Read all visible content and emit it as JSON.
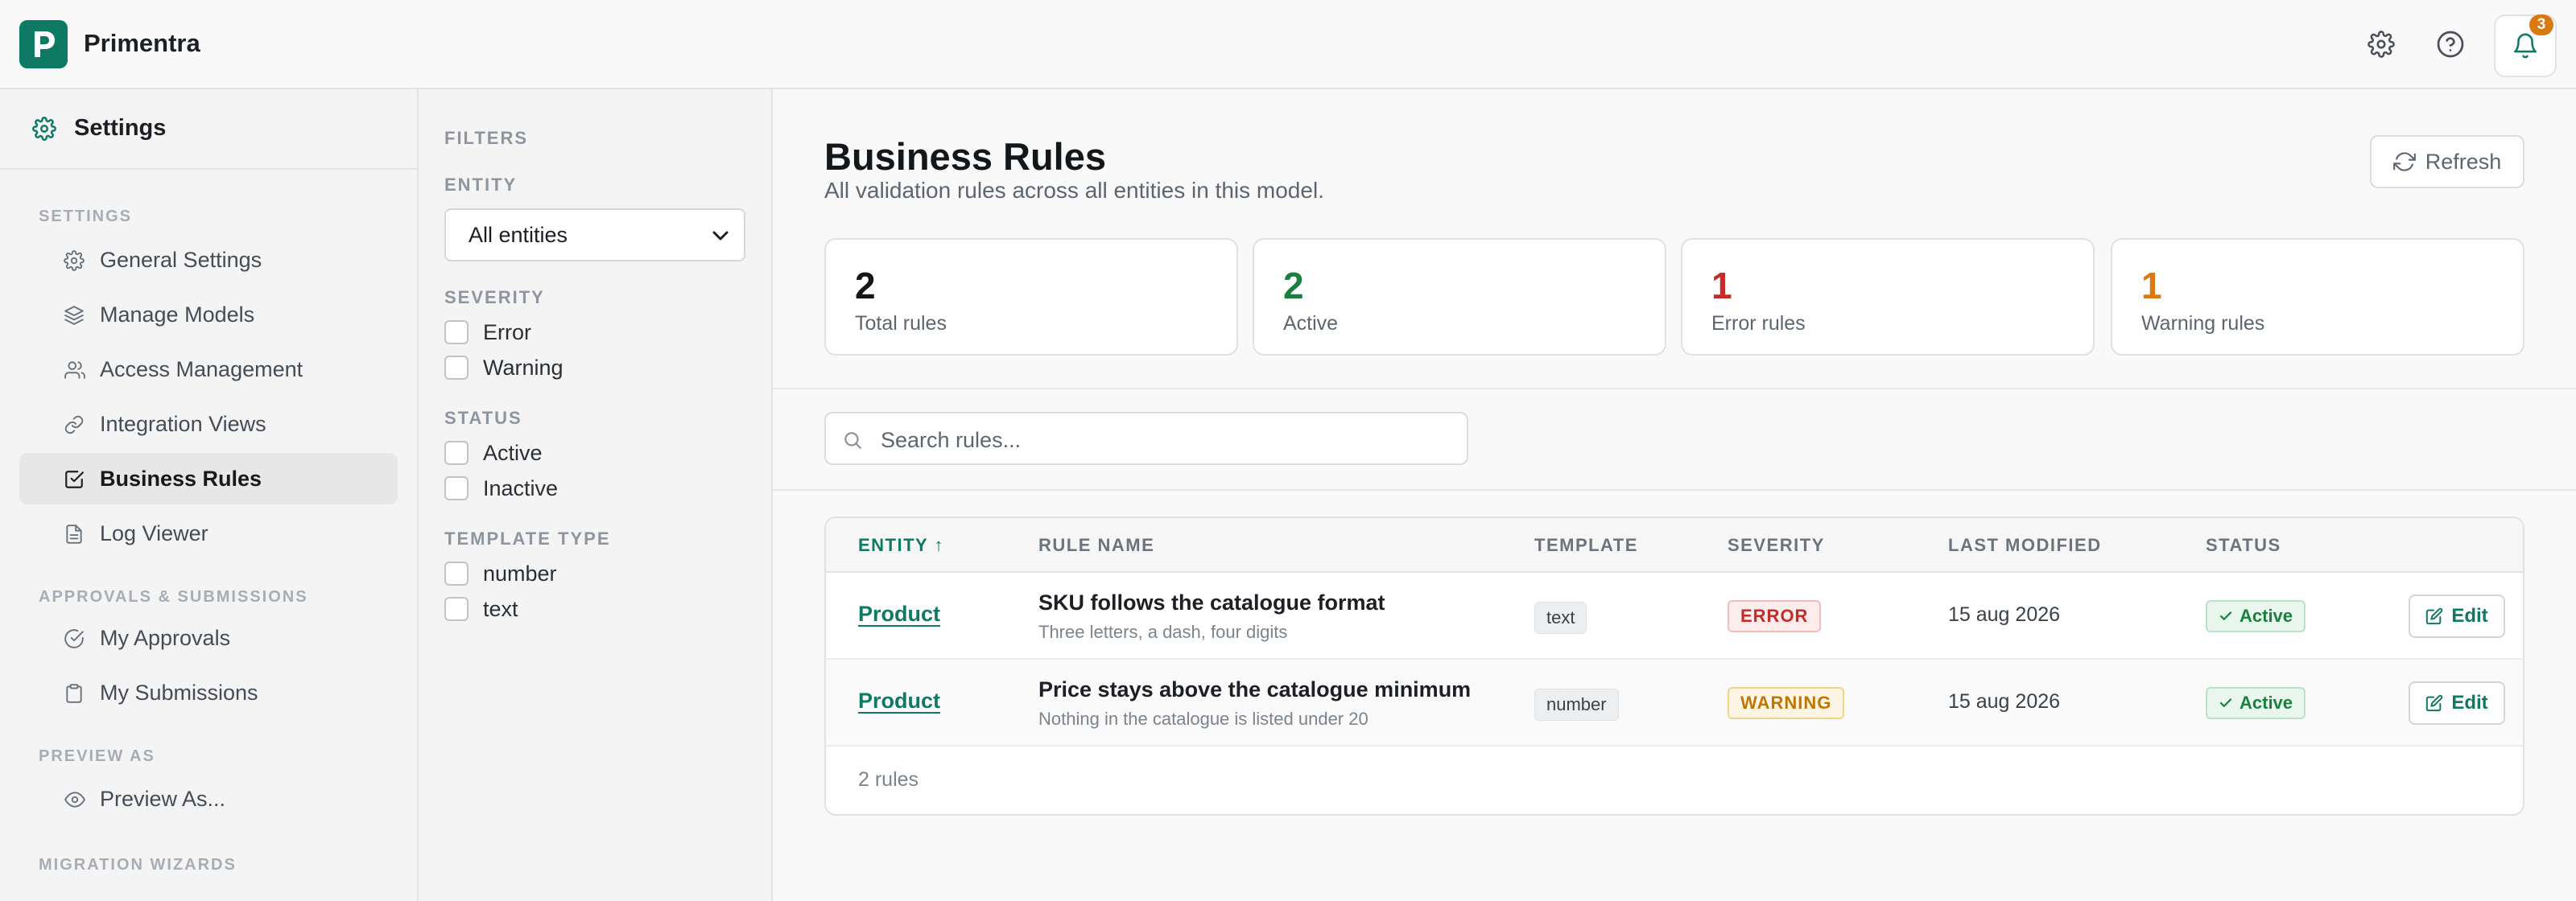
{
  "app": {
    "name": "Primentra",
    "logo_letter": "P",
    "brand_color": "#0f7a63"
  },
  "header": {
    "icons": [
      "gear-icon",
      "help-icon",
      "bell-icon"
    ],
    "notification_count": "3"
  },
  "sidebar": {
    "title": "Settings",
    "sections": [
      {
        "title": "SETTINGS"
      },
      {
        "title": "APPROVALS & SUBMISSIONS"
      },
      {
        "title": "PREVIEW AS"
      },
      {
        "title": "MIGRATION WIZARDS"
      }
    ],
    "items": [
      {
        "label": "General Settings",
        "icon": "gear-icon"
      },
      {
        "label": "Manage Models",
        "icon": "layers-icon"
      },
      {
        "label": "Access Management",
        "icon": "users-icon"
      },
      {
        "label": "Integration Views",
        "icon": "link-icon"
      },
      {
        "label": "Business Rules",
        "icon": "check-square-icon",
        "active": true
      },
      {
        "label": "Log Viewer",
        "icon": "file-icon"
      },
      {
        "label": "My Approvals",
        "icon": "check-circle-icon"
      },
      {
        "label": "My Submissions",
        "icon": "clipboard-icon"
      },
      {
        "label": "Preview As...",
        "icon": "eye-icon"
      }
    ]
  },
  "filters": {
    "title": "FILTERS",
    "entity": {
      "title": "ENTITY",
      "selected": "All entities"
    },
    "severity": {
      "title": "SEVERITY",
      "options": [
        "Error",
        "Warning"
      ]
    },
    "status": {
      "title": "STATUS",
      "options": [
        "Active",
        "Inactive"
      ]
    },
    "template_type": {
      "title": "TEMPLATE TYPE",
      "options": [
        "number",
        "text"
      ]
    }
  },
  "main": {
    "title": "Business Rules",
    "subtitle": "All validation rules across all entities in this model.",
    "refresh_label": "Refresh",
    "stats": [
      {
        "value": "2",
        "label": "Total rules",
        "color": "#14171a"
      },
      {
        "value": "2",
        "label": "Active",
        "color": "#1a7f3f"
      },
      {
        "value": "1",
        "label": "Error rules",
        "color": "#c52b2b"
      },
      {
        "value": "1",
        "label": "Warning rules",
        "color": "#d9790f"
      }
    ],
    "search": {
      "placeholder": "Search rules..."
    },
    "table": {
      "columns": [
        "ENTITY ↑",
        "RULE NAME",
        "TEMPLATE",
        "SEVERITY",
        "LAST MODIFIED",
        "STATUS"
      ],
      "rows": [
        {
          "entity": "Product",
          "rule_name": "SKU follows the catalogue format",
          "rule_desc": "Three letters, a dash, four digits",
          "template": "text",
          "severity": "ERROR",
          "last_modified": "15 aug 2026",
          "status": "Active",
          "action": "Edit"
        },
        {
          "entity": "Product",
          "rule_name": "Price stays above the catalogue minimum",
          "rule_desc": "Nothing in the catalogue is listed under 20",
          "template": "number",
          "severity": "WARNING",
          "last_modified": "15 aug 2026",
          "status": "Active",
          "action": "Edit"
        }
      ],
      "footer": "2 rules"
    }
  }
}
